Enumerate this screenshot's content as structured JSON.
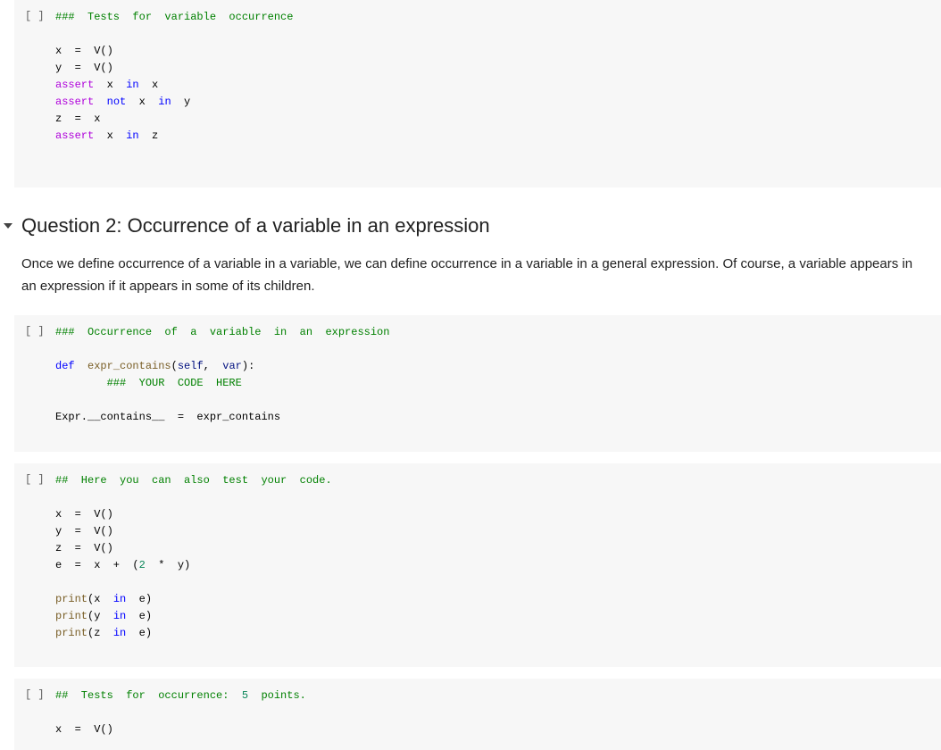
{
  "run_button_label": "[ ]",
  "cells": [
    {
      "lines": [
        [
          [
            "comment",
            "###  Tests  for  variable  occurrence"
          ]
        ],
        [],
        [
          [
            "plain",
            "x  =  V()"
          ]
        ],
        [
          [
            "plain",
            "y  =  V()"
          ]
        ],
        [
          [
            "ctrl",
            "assert"
          ],
          [
            "plain",
            "  x  "
          ],
          [
            "kw",
            "in"
          ],
          [
            "plain",
            "  x"
          ]
        ],
        [
          [
            "ctrl",
            "assert"
          ],
          [
            "plain",
            "  "
          ],
          [
            "kw",
            "not"
          ],
          [
            "plain",
            "  x  "
          ],
          [
            "kw",
            "in"
          ],
          [
            "plain",
            "  y"
          ]
        ],
        [
          [
            "plain",
            "z  =  x"
          ]
        ],
        [
          [
            "ctrl",
            "assert"
          ],
          [
            "plain",
            "  x  "
          ],
          [
            "kw",
            "in"
          ],
          [
            "plain",
            "  z"
          ]
        ]
      ]
    },
    {
      "lines": [
        [
          [
            "comment",
            "###  Occurrence  of  a  variable  in  an  expression"
          ]
        ],
        [],
        [
          [
            "kw",
            "def"
          ],
          [
            "plain",
            "  "
          ],
          [
            "fn",
            "expr_contains"
          ],
          [
            "plain",
            "("
          ],
          [
            "param",
            "self"
          ],
          [
            "plain",
            ",  "
          ],
          [
            "param",
            "var"
          ],
          [
            "plain",
            "):"
          ]
        ],
        [
          [
            "plain",
            "        "
          ],
          [
            "comment",
            "###  YOUR  CODE  HERE"
          ]
        ],
        [],
        [
          [
            "plain",
            "Expr.__contains__  =  expr_contains"
          ]
        ]
      ]
    },
    {
      "lines": [
        [
          [
            "comment",
            "##  Here  you  can  also  test  your  code."
          ]
        ],
        [],
        [
          [
            "plain",
            "x  =  V()"
          ]
        ],
        [
          [
            "plain",
            "y  =  V()"
          ]
        ],
        [
          [
            "plain",
            "z  =  V()"
          ]
        ],
        [
          [
            "plain",
            "e  =  x  +  ("
          ],
          [
            "num",
            "2"
          ],
          [
            "plain",
            "  *  y)"
          ]
        ],
        [],
        [
          [
            "fn",
            "print"
          ],
          [
            "plain",
            "(x  "
          ],
          [
            "kw",
            "in"
          ],
          [
            "plain",
            "  e)"
          ]
        ],
        [
          [
            "fn",
            "print"
          ],
          [
            "plain",
            "(y  "
          ],
          [
            "kw",
            "in"
          ],
          [
            "plain",
            "  e)"
          ]
        ],
        [
          [
            "fn",
            "print"
          ],
          [
            "plain",
            "(z  "
          ],
          [
            "kw",
            "in"
          ],
          [
            "plain",
            "  e)"
          ]
        ]
      ]
    },
    {
      "lines": [
        [
          [
            "comment",
            "##  Tests  for  occurrence:  "
          ],
          [
            "num",
            "5"
          ],
          [
            "comment",
            "  points."
          ]
        ],
        [],
        [
          [
            "plain",
            "x  =  V()"
          ]
        ]
      ]
    }
  ],
  "section": {
    "heading": "Question 2: Occurrence of a variable in an expression",
    "paragraph": "Once we define occurrence of a variable in a variable, we can define occurrence in a variable in a general expression. Of course, a variable appears in an expression if it appears in some of its children.",
    "collapse_icon": "caret-down-icon"
  }
}
